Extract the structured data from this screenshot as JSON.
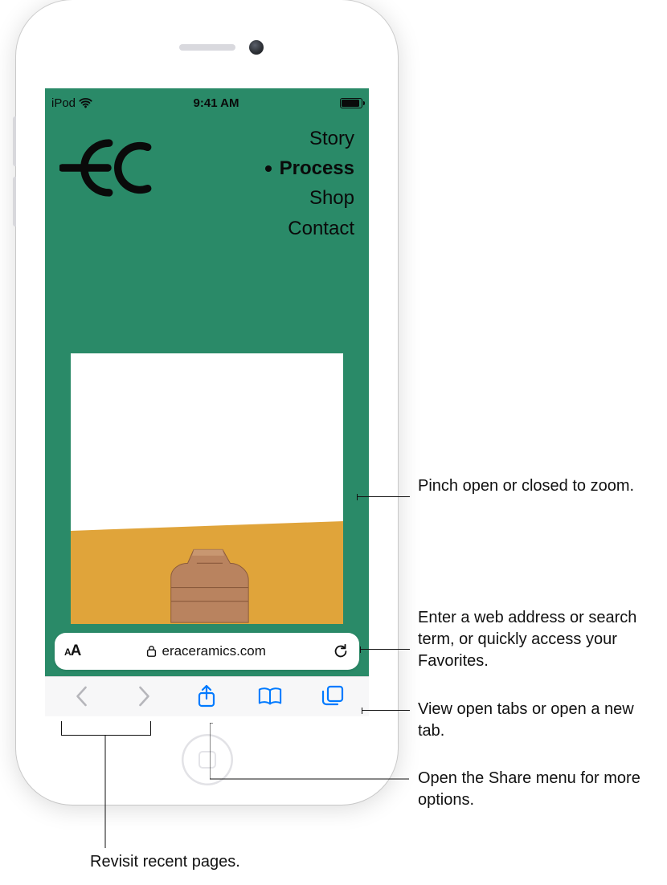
{
  "status_bar": {
    "device_name": "iPod",
    "time": "9:41 AM"
  },
  "website": {
    "nav": {
      "items": [
        {
          "label": "Story",
          "active": false
        },
        {
          "label": "Process",
          "active": true
        },
        {
          "label": "Shop",
          "active": false
        },
        {
          "label": "Contact",
          "active": false
        }
      ]
    }
  },
  "address_bar": {
    "domain": "eraceramics.com"
  },
  "callouts": {
    "zoom": "Pinch open or closed to zoom.",
    "address": "Enter a web address or search term, or quickly access your Favorites.",
    "tabs": "View open tabs or open a new tab.",
    "share": "Open the Share menu for more options.",
    "history": "Revisit recent pages."
  }
}
